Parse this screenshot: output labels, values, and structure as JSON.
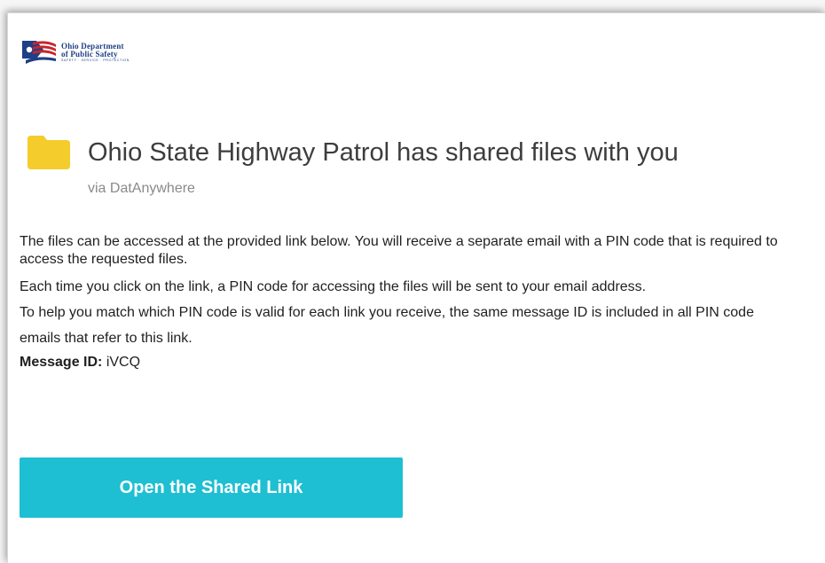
{
  "logo": {
    "line1": "Ohio Department",
    "line2": "of Public Safety",
    "line3": "SAFETY · SERVICE · PROTECTION"
  },
  "header": {
    "icon": "folder-icon",
    "title": "Ohio State Highway Patrol has shared files with you",
    "via": "via DatAnywhere"
  },
  "body": {
    "paragraph1": "The files can be accessed at the provided link below. You will receive a separate email with a PIN code that is required to access the requested files.",
    "paragraph2": "Each time you click on the link, a PIN code for accessing the files will be sent to your email address.",
    "paragraph3": "To help you match which PIN code is valid for each link you receive, the same message ID is included in all PIN code emails that refer to this link.",
    "message_id_label": "Message ID:",
    "message_id_value": "iVCQ"
  },
  "cta": {
    "label": "Open the Shared Link"
  },
  "colors": {
    "button": "#1ebfd2",
    "folder": "#f4cc2b",
    "logo_blue": "#1f3f86",
    "logo_red": "#c7262c"
  }
}
